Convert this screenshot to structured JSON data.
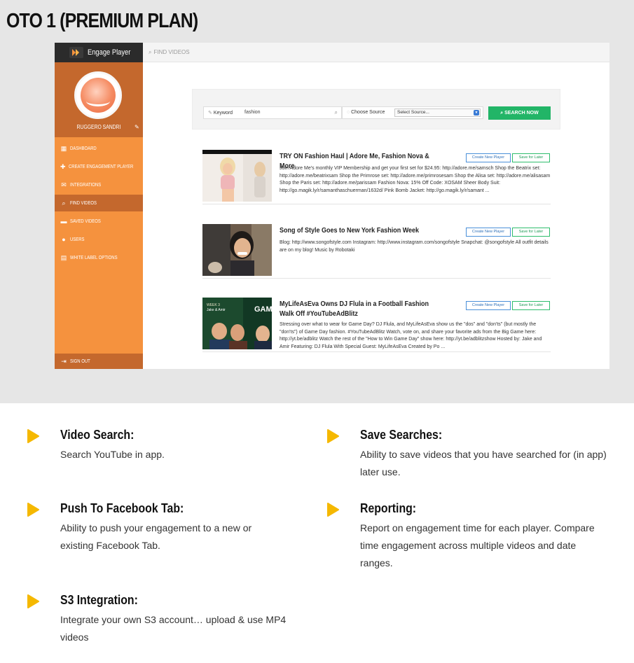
{
  "page_title": "OTO 1 (PREMIUM PLAN)",
  "colors": {
    "sidebar": "#f5923e",
    "sidebar_active": "#c4682d",
    "accent_green": "#22b567",
    "feature_icon": "#f5b800"
  },
  "app": {
    "logo_text": "Engage Player",
    "profile_name": "RUGGERO SANDRI",
    "topbar_label": "FIND VIDEOS",
    "nav": [
      {
        "label": "DASHBOARD",
        "icon": "grid-icon"
      },
      {
        "label": "CREATE ENGAGEMENT PLAYER",
        "icon": "plus-icon"
      },
      {
        "label": "INTEGRATIONS",
        "icon": "mail-icon"
      },
      {
        "label": "FIND VIDEOS",
        "icon": "search-icon",
        "active": true
      },
      {
        "label": "SAVED VIDEOS",
        "icon": "folder-icon"
      },
      {
        "label": "USERS",
        "icon": "users-icon"
      },
      {
        "label": "WHITE LABEL OPTIONS",
        "icon": "document-icon"
      }
    ],
    "signout_label": "SIGN OUT",
    "search": {
      "keyword_label": "Keyword",
      "keyword_value": "fashion",
      "source_label": "Choose Source",
      "source_value": "Select Source...",
      "button_label": "SEARCH NOW"
    },
    "result_buttons": {
      "create": "Create New Player",
      "save": "Save for Later"
    },
    "results": [
      {
        "title": "TRY ON Fashion Haul | Adore Me, Fashion Nova & More",
        "description": "Join Adore Me's monthly VIP Membership and get your first set for $24.95: http://adore.me/samsch Shop the Beatrix set: http://adore.me/beatrixsam Shop the Primrose set: http://adore.me/primrosesam Shop the Alisa set: http://adore.me/alisasam Shop the Paris set: http://adore.me/parissam Fashion Nova: 15% Off Code: XOSAM Sheer Body Suit: http://go.magik.ly/r/samanthaschuerman/1632d/ Pink Bomb Jacket: http://go.magik.ly/r/samant ..."
      },
      {
        "title": "Song of Style Goes to New York Fashion Week",
        "description": "Blog: http://www.songofstyle.com Instagram: http://www.instagram.com/songofstyle Snapchat: @songofstyle All outfit details are on my blog! Music by Robotaki"
      },
      {
        "title": "MyLifeAsEva Owns DJ Flula in a Football Fashion Walk Off #YouTubeAdBlitz",
        "description": "Stressing over what to wear for Game Day? DJ Flula, and MyLifeAsEva show us the \"dos\" and \"don'ts\" (but mostly the \"don'ts\") of Game Day fashion. #YouTubeAdBlitz Watch, vote on, and share your favorite ads from the Big Game here: http://yt.be/adblitz Watch the rest of the \"How to Win Game Day\" show here: http://yt.be/adblitzshow Hosted by: Jake and Amir Featuring: DJ Flula With Special Guest: MyLifeAsEva Created by Po ..."
      }
    ]
  },
  "features": [
    {
      "title": "Video Search:",
      "description": "Search YouTube in app.",
      "icon": "play-arrow-icon"
    },
    {
      "title": "Save Searches:",
      "description": "Ability to save videos that you have searched for (in app) later use.",
      "icon": "play-arrow-icon"
    },
    {
      "title": "Push To Facebook Tab:",
      "description": "Ability to push your engagement to a new or existing Facebook Tab.",
      "icon": "play-arrow-icon"
    },
    {
      "title": "Reporting:",
      "description": "Report on engagement time for each player. Compare time engagement across multiple videos and date ranges.",
      "icon": "play-arrow-icon"
    },
    {
      "title": "S3 Integration:",
      "description": "Integrate your own S3 account… upload & use MP4 videos",
      "icon": "play-arrow-icon"
    }
  ]
}
